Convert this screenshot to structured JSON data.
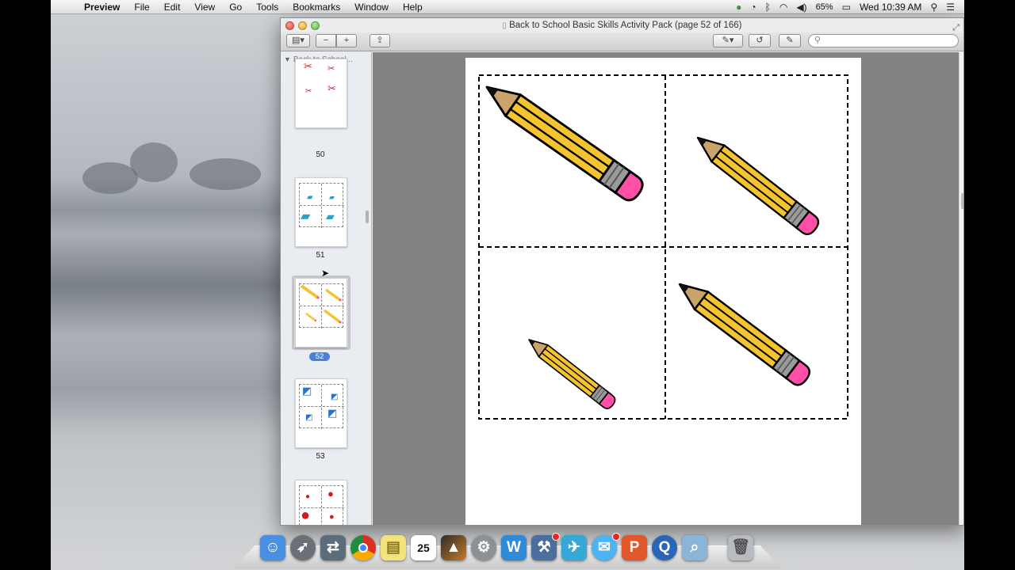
{
  "menubar": {
    "apple_icon": "apple-logo",
    "app_name": "Preview",
    "items": [
      "File",
      "Edit",
      "View",
      "Go",
      "Tools",
      "Bookmarks",
      "Window",
      "Help"
    ],
    "battery_percent": "65%",
    "clock": "Wed 10:39 AM"
  },
  "window": {
    "title": "Back to School Basic Skills Activity Pack (page 52 of 166)",
    "toolbar": {
      "sidebar_toggle_label": "▤▾",
      "zoom_out_label": "−",
      "zoom_in_label": "+",
      "share_label": "⇪",
      "annotate_label": "✎▾",
      "rotate_label": "↺",
      "edit_label": "✎"
    },
    "search": {
      "placeholder": ""
    }
  },
  "sidebar": {
    "header": "Back to School...",
    "thumbnails": [
      {
        "page": "50",
        "icon": "scissors"
      },
      {
        "page": "51",
        "icon": "book"
      },
      {
        "page": "52",
        "icon": "pencil",
        "selected": true
      },
      {
        "page": "53",
        "icon": "glue-stick"
      },
      {
        "page": "",
        "icon": "apple"
      }
    ]
  },
  "document": {
    "current_page": 52,
    "total_pages": 166,
    "cards": [
      {
        "icon": "pencil",
        "scale": "largest"
      },
      {
        "icon": "pencil",
        "scale": "medium"
      },
      {
        "icon": "pencil",
        "scale": "smallest"
      },
      {
        "icon": "pencil",
        "scale": "large"
      }
    ]
  },
  "dock": {
    "apps": [
      {
        "name": "Finder",
        "icon": "finder-icon",
        "color": "#4a90e2"
      },
      {
        "name": "Launchpad",
        "icon": "rocket-icon",
        "color": "#6b6f78"
      },
      {
        "name": "Migration",
        "icon": "migration-icon",
        "color": "#5b6c7a"
      },
      {
        "name": "Chrome",
        "icon": "chrome-icon",
        "color": "#e6e6e6"
      },
      {
        "name": "Stickies",
        "icon": "stickies-icon",
        "color": "#f4e27c"
      },
      {
        "name": "Calendar",
        "icon": "calendar-icon",
        "color": "#ffffff",
        "label": "25"
      },
      {
        "name": "Photo",
        "icon": "photo-icon",
        "color": "#2b2b2b"
      },
      {
        "name": "System Preferences",
        "icon": "gear-icon",
        "color": "#8d9095"
      },
      {
        "name": "Word",
        "icon": "word-icon",
        "color": "#2f8ad8",
        "label": "W"
      },
      {
        "name": "Xcode",
        "icon": "xcode-icon",
        "color": "#4b6e9c"
      },
      {
        "name": "Airmail",
        "icon": "bird-icon",
        "color": "#36a8d8"
      },
      {
        "name": "Messages",
        "icon": "messages-icon",
        "color": "#4cb4f5"
      },
      {
        "name": "PowerPoint",
        "icon": "powerpoint-icon",
        "color": "#e2572c",
        "label": "P"
      },
      {
        "name": "QuickTime",
        "icon": "quicktime-icon",
        "color": "#2a66b8"
      },
      {
        "name": "Preview",
        "icon": "preview-icon",
        "color": "#8ab4d8"
      },
      {
        "name": "Trash",
        "icon": "trash-icon",
        "color": "#b8bbbf"
      }
    ]
  },
  "colors": {
    "pencil_body": "#f4c430",
    "pencil_stripe": "#d9a514",
    "pencil_wood": "#c9a36a",
    "pencil_ferrule": "#9a9a9a",
    "pencil_eraser": "#ff4fa8",
    "selection_blue": "#4c7fd6"
  }
}
